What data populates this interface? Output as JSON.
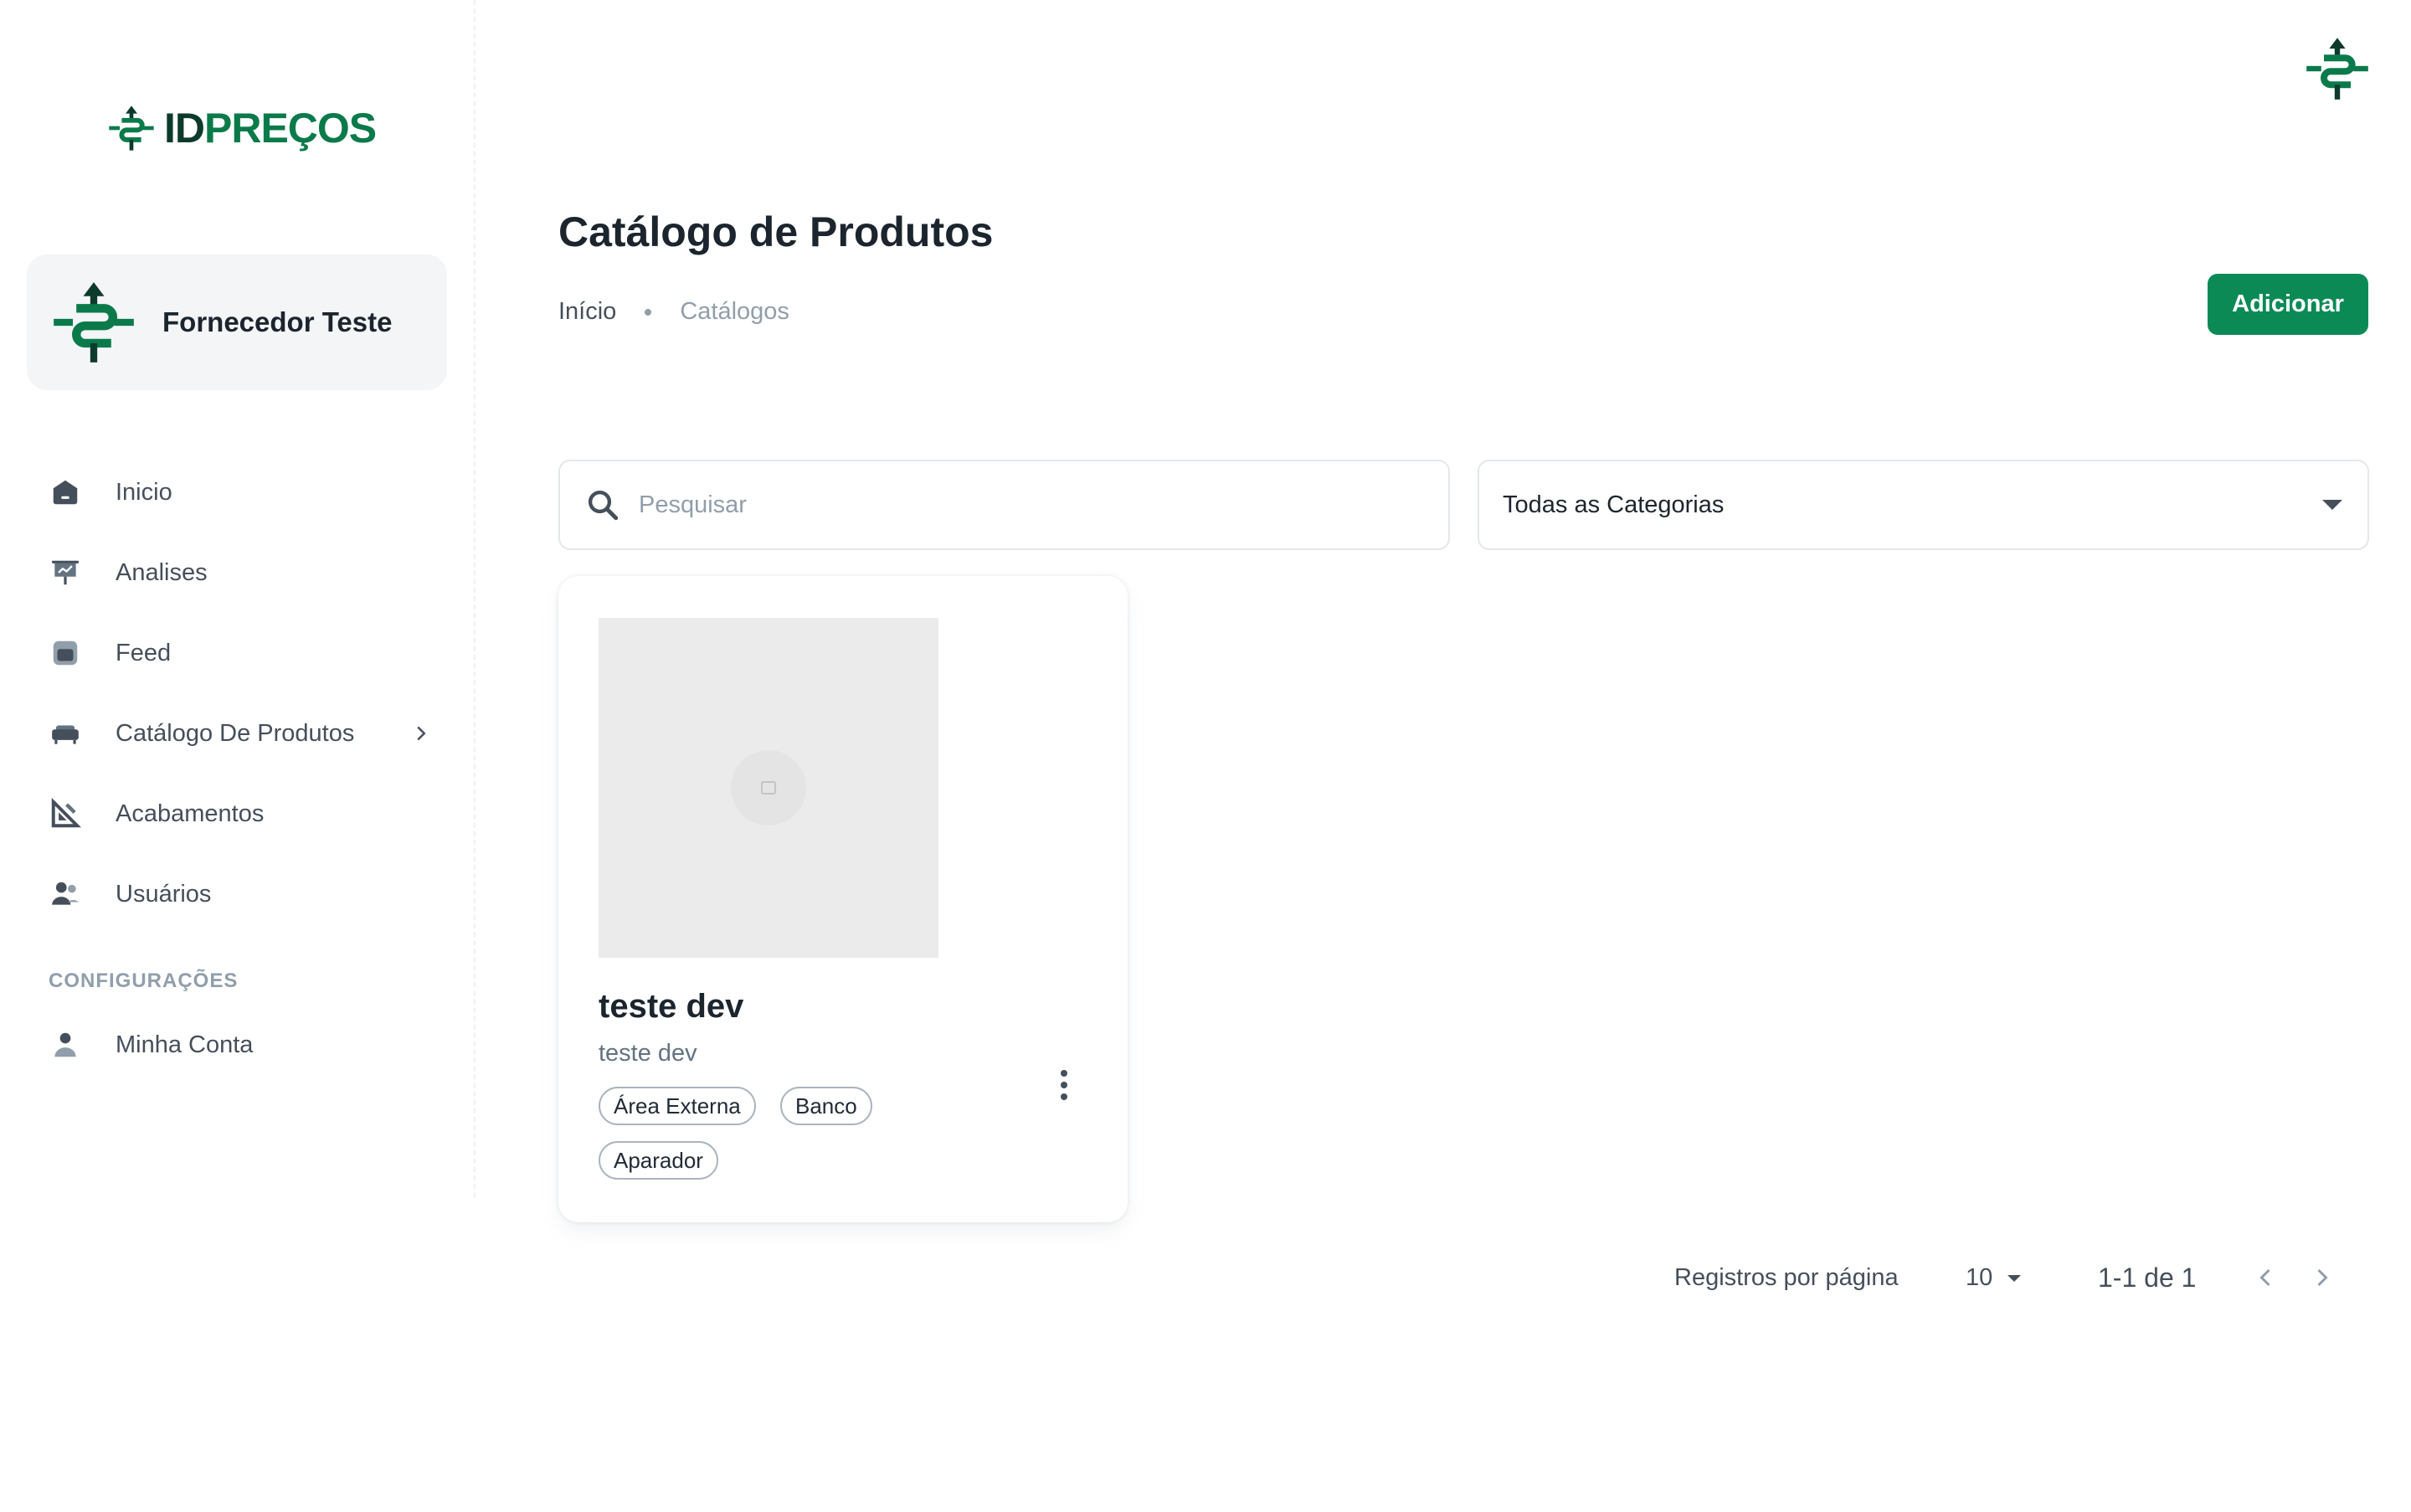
{
  "brand": {
    "logo_text_id": "ID",
    "logo_text_rest": "PREÇOS",
    "logo_icon": "dollar-compass-icon",
    "primary_color": "#0b8a56",
    "dark_color": "#0d3b2b"
  },
  "account": {
    "name": "Fornecedor Teste",
    "avatar_icon": "dollar-compass-icon"
  },
  "sidebar": {
    "items": [
      {
        "label": "Inicio",
        "icon": "home-icon"
      },
      {
        "label": "Analises",
        "icon": "presentation-chart-icon"
      },
      {
        "label": "Feed",
        "icon": "feed-icon"
      },
      {
        "label": "Catálogo De Produtos",
        "icon": "sofa-icon",
        "has_submenu": true
      },
      {
        "label": "Acabamentos",
        "icon": "ruler-square-icon"
      },
      {
        "label": "Usuários",
        "icon": "users-icon"
      }
    ],
    "section_title": "CONFIGURAÇÕES",
    "settings_items": [
      {
        "label": "Minha Conta",
        "icon": "user-icon"
      }
    ]
  },
  "header": {
    "title": "Catálogo de Produtos",
    "breadcrumb": [
      "Início",
      "Catálogos"
    ],
    "add_button_label": "Adicionar"
  },
  "filters": {
    "search_placeholder": "Pesquisar",
    "search_value": "",
    "category_selected": "Todas as Categorias"
  },
  "products": [
    {
      "name": "teste dev",
      "description": "teste dev",
      "tags": [
        "Área Externa",
        "Banco",
        "Aparador"
      ]
    }
  ],
  "pagination": {
    "rows_per_page_label": "Registros por página",
    "rows_per_page_value": "10",
    "range_text": "1-1 de 1"
  }
}
